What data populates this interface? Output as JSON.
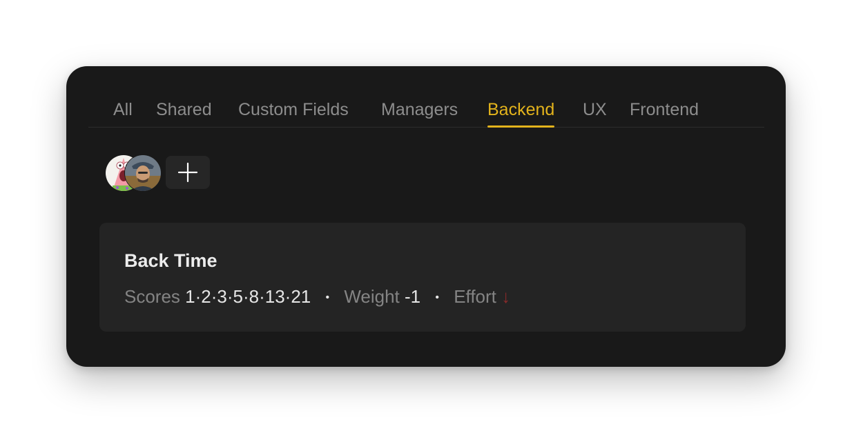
{
  "tabs": [
    {
      "label": "All",
      "active": false
    },
    {
      "label": "Shared",
      "active": false
    },
    {
      "label": "Custom Fields",
      "active": false
    },
    {
      "label": "Managers",
      "active": false
    },
    {
      "label": "Backend",
      "active": true
    },
    {
      "label": "UX",
      "active": false
    },
    {
      "label": "Frontend",
      "active": false
    }
  ],
  "colors": {
    "accent": "#e3b31c",
    "card_bg": "#191919",
    "panel_bg": "#242424",
    "effort_arrow": "#8a2a2a"
  },
  "members": {
    "avatars": [
      "avatar-starfish-character",
      "avatar-man-in-cap"
    ],
    "add_icon": "plus-icon"
  },
  "field": {
    "title": "Back Time",
    "scores_label": "Scores",
    "scores_value": "1·2·3·5·8·13·21",
    "separator": "•",
    "weight_label": "Weight",
    "weight_value": "-1",
    "effort_label": "Effort",
    "effort_icon": "arrow-down-icon",
    "effort_symbol": "↓"
  }
}
